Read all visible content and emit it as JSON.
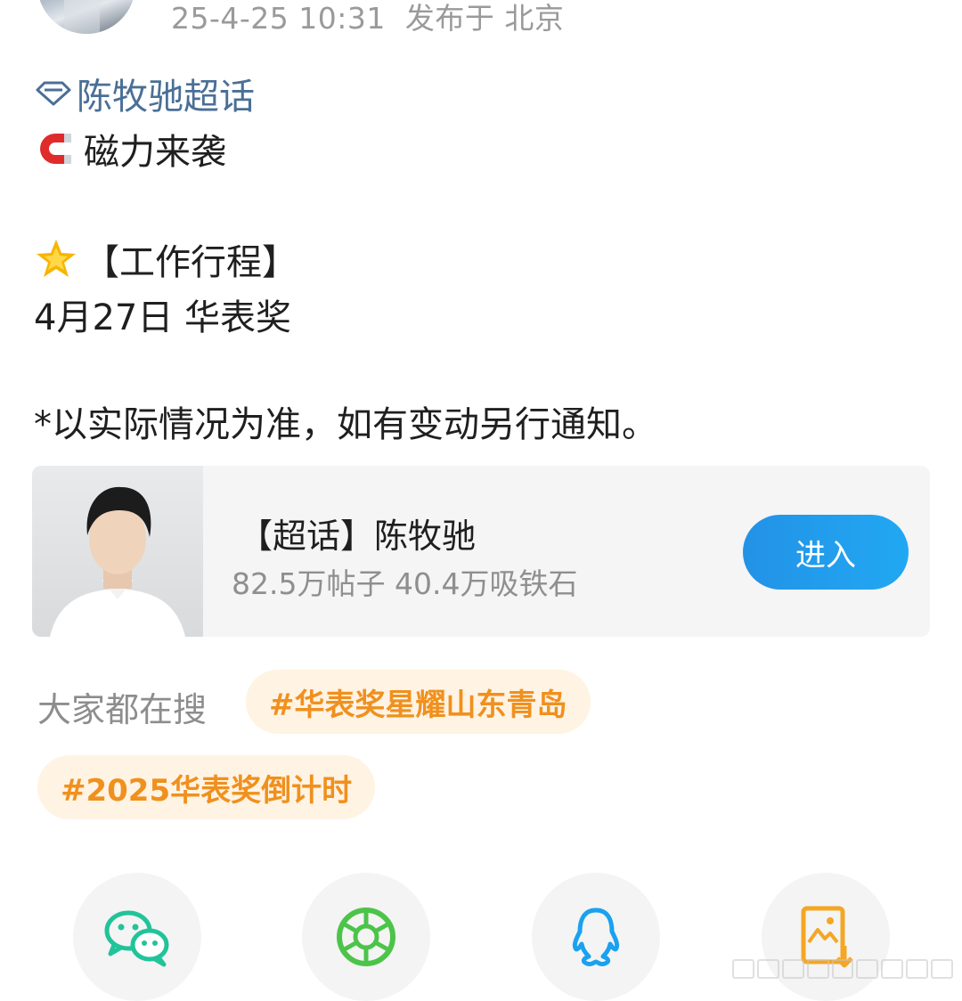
{
  "post": {
    "time": "25-4-25 10:31",
    "location": "发布于 北京",
    "topic_link": "陈牧驰超话",
    "line1": "磁力来袭",
    "line2": "【工作行程】",
    "line3": "4月27日 华表奖",
    "line4": "*以实际情况为准，如有变动另行通知。"
  },
  "topic_card": {
    "title": "【超话】陈牧驰",
    "stats": "82.5万帖子 40.4万吸铁石",
    "enter_label": "进入"
  },
  "trending": {
    "label": "大家都在搜",
    "tags": [
      "#华表奖星耀山东青岛",
      "#2025华表奖倒计时"
    ]
  },
  "share": {
    "items": [
      "wechat-icon",
      "moments-icon",
      "qq-icon",
      "save-image-icon"
    ]
  },
  "colors": {
    "link": "#4a6f97",
    "accent_blue": "#2392e6",
    "tag_text": "#f0901e",
    "tag_bg": "#fff3e3"
  }
}
